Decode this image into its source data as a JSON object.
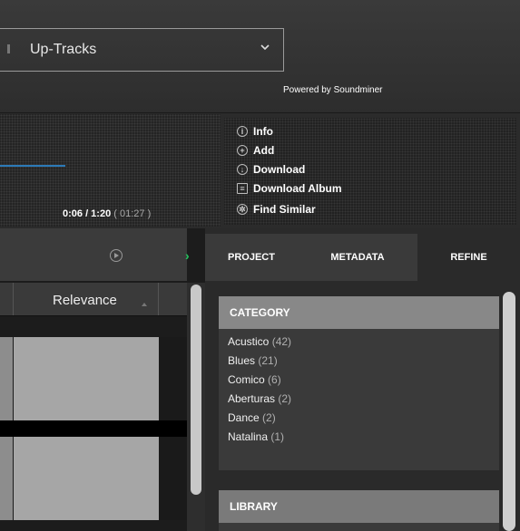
{
  "header": {
    "dropdown_value": "Up-Tracks",
    "powered_prefix": "Powered by",
    "powered_brand": "Soundminer"
  },
  "player": {
    "time_current": "0:06 / 1:20",
    "time_duration": "( 01:27 )",
    "accent_color": "#2c7ab8"
  },
  "actions": [
    {
      "label": "Info",
      "icon": "info-icon"
    },
    {
      "label": "Add",
      "icon": "plus-circle-icon"
    },
    {
      "label": "Download",
      "icon": "download-icon"
    },
    {
      "label": "Download Album",
      "icon": "album-download-icon"
    },
    {
      "label": "Find Similar",
      "icon": "find-similar-icon"
    }
  ],
  "results": {
    "column_header": "Relevance"
  },
  "tabs": [
    {
      "label": "PROJECT",
      "active": false
    },
    {
      "label": "METADATA",
      "active": false
    },
    {
      "label": "REFINE",
      "active": true
    }
  ],
  "refine": {
    "category": {
      "title": "CATEGORY",
      "items": [
        {
          "name": "Acustico",
          "count": "(42)"
        },
        {
          "name": "Blues",
          "count": "(21)"
        },
        {
          "name": "Comico",
          "count": "(6)"
        },
        {
          "name": "Aberturas",
          "count": "(2)"
        },
        {
          "name": "Dance",
          "count": "(2)"
        },
        {
          "name": "Natalina",
          "count": "(1)"
        }
      ]
    },
    "library": {
      "title": "LIBRARY"
    }
  },
  "colors": {
    "play_arrow": "#22c55e"
  }
}
